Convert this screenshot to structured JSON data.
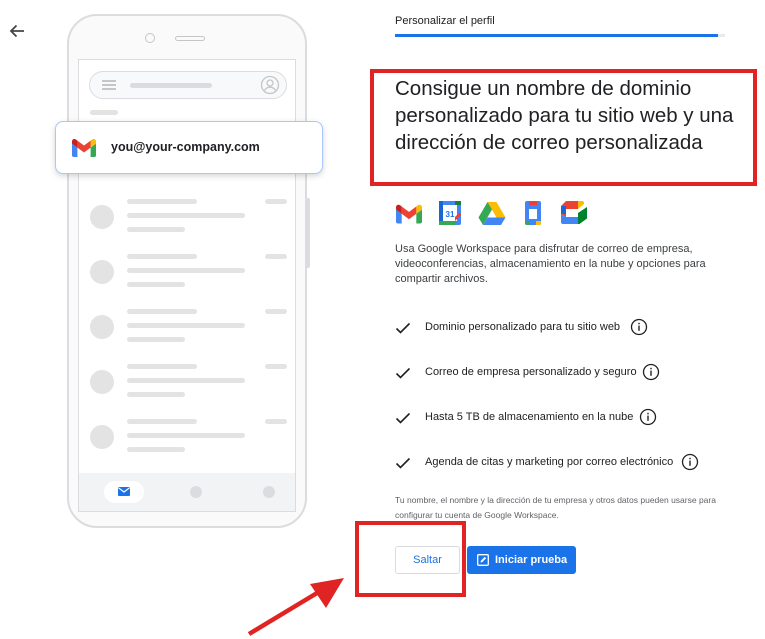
{
  "nav": {
    "back_icon": "arrow-back-icon"
  },
  "mockup": {
    "email_address": "you@your-company.com",
    "gmail_icon": "gmail-logo-icon"
  },
  "step": {
    "label": "Personalizar el perfil",
    "progress": 0.98
  },
  "headline": "Consigue un nombre de dominio personalizado para tu sitio web y una dirección de correo personalizada",
  "apps": [
    "gmail-icon",
    "calendar-icon",
    "drive-icon",
    "docs-icon",
    "meet-icon"
  ],
  "description": "Usa Google Workspace para disfrutar de correo de empresa, videoconferencias, almacenamiento en la nube y opciones para compartir archivos.",
  "features": [
    {
      "label": "Dominio personalizado para tu sitio web"
    },
    {
      "label": "Correo de empresa personalizado y seguro"
    },
    {
      "label": "Hasta 5 TB de almacenamiento en la nube"
    },
    {
      "label": "Agenda de citas y marketing por correo electrónico"
    }
  ],
  "fine_print": "Tu nombre, el nombre y la dirección de tu empresa y otros datos pueden usarse para configurar tu cuenta de Google Workspace.",
  "buttons": {
    "skip": "Saltar",
    "trial": "Iniciar prueba"
  },
  "colors": {
    "accent": "#1a73e8",
    "highlight": "#e02424"
  }
}
